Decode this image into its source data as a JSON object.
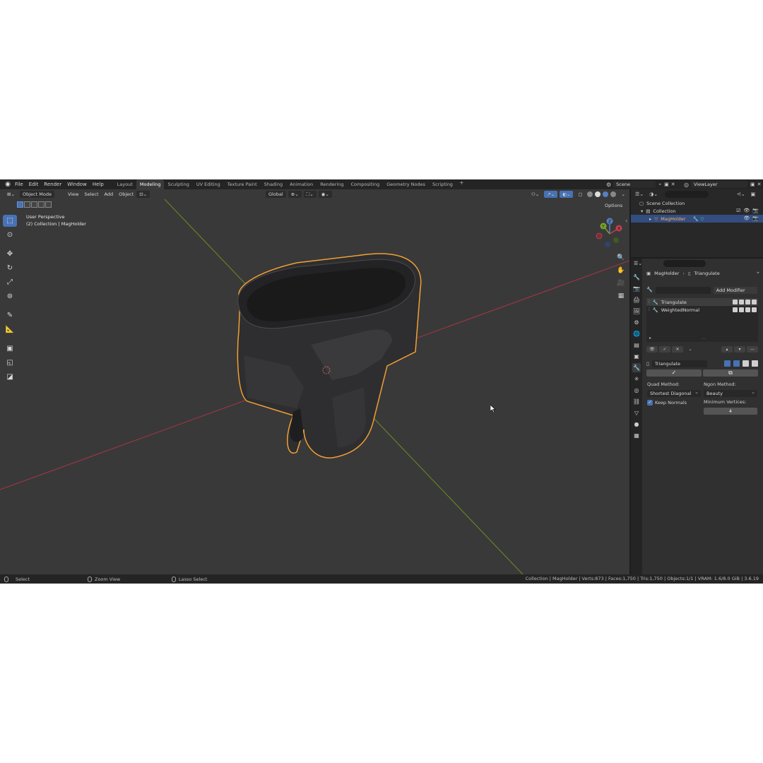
{
  "topbar": {
    "menus": [
      "File",
      "Edit",
      "Render",
      "Window",
      "Help"
    ],
    "workspaces": [
      "Layout",
      "Modeling",
      "Sculpting",
      "UV Editing",
      "Texture Paint",
      "Shading",
      "Animation",
      "Rendering",
      "Compositing",
      "Geometry Nodes",
      "Scripting"
    ],
    "active_workspace": "Modeling",
    "scene": "Scene",
    "view_layer": "ViewLayer"
  },
  "viewport": {
    "mode": "Object Mode",
    "menus": [
      "View",
      "Select",
      "Add",
      "Object"
    ],
    "orientation": "Global",
    "options_label": "Options",
    "overlay_line1": "User Perspective",
    "overlay_line2": "(2) Collection | MagHolder",
    "gizmo_labels": {
      "z": "Z",
      "y": "Y",
      "x": "X"
    },
    "colors": {
      "background": "#393939",
      "x_axis": "#b03a48",
      "y_axis": "#7a9a2a",
      "selection_outline": "#f5a030"
    }
  },
  "outliner": {
    "root": "Scene Collection",
    "collection": "Collection",
    "object": "MagHolder"
  },
  "properties": {
    "breadcrumb_object": "MagHolder",
    "breadcrumb_modifier": "Triangulate",
    "add_modifier": "Add Modifier",
    "modifiers": [
      "Triangulate",
      "WeightedNormal"
    ],
    "active_modifier_name": "Triangulate",
    "quad_method_label": "Quad Method:",
    "quad_method_value": "Shortest Diagonal",
    "ngon_method_label": "Ngon Method:",
    "ngon_method_value": "Beauty",
    "keep_normals_label": "Keep Normals",
    "keep_normals": true,
    "min_vertices_label": "Minimum Vertices:",
    "min_vertices_value": "4"
  },
  "statusbar": {
    "left1": "Select",
    "left2": "Zoom View",
    "left3": "Lasso Select",
    "right": "Collection | MagHolder | Verts:873 | Faces:1,750 | Tris:1,750 | Objects:1/1 | VRAM: 1.6/8.0 GiB | 3.6.19"
  }
}
